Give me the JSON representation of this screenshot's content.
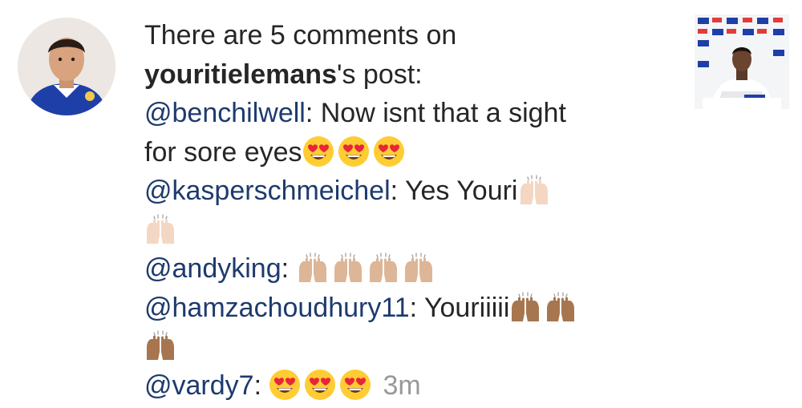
{
  "notification": {
    "intro": "There are 5 comments on",
    "post_owner": "youritielemans",
    "post_suffix": "'s post:",
    "time_ago": "3m"
  },
  "comments": [
    {
      "handle": "@benchilwell",
      "sep": ":",
      "text_part1": "Now isnt that a sight",
      "text_part2": "for sore eyes",
      "emojis": [
        "heart-eyes-emoji",
        "heart-eyes-emoji",
        "heart-eyes-emoji"
      ]
    },
    {
      "handle": "@kasperschmeichel",
      "sep": ":",
      "text": "Yes Youri",
      "emojis": [
        "raising-hands-light-emoji",
        "raising-hands-light-emoji"
      ]
    },
    {
      "handle": "@andyking",
      "sep": ":",
      "emojis": [
        "raising-hands-medium-light-emoji",
        "raising-hands-medium-light-emoji",
        "raising-hands-medium-light-emoji",
        "raising-hands-medium-light-emoji"
      ]
    },
    {
      "handle": "@hamzachoudhury11",
      "sep": ":",
      "text": "Youriiiii",
      "emojis": [
        "raising-hands-medium-emoji",
        "raising-hands-medium-emoji",
        "raising-hands-medium-emoji"
      ]
    },
    {
      "handle": "@vardy7",
      "sep": ":",
      "emojis": [
        "heart-eyes-emoji",
        "heart-eyes-emoji",
        "heart-eyes-emoji"
      ]
    }
  ],
  "colors": {
    "text": "#262626",
    "mention": "#1e3a6e",
    "timestamp": "#999999",
    "skin_light": "#f3d7c3",
    "skin_medium_light": "#ddb697",
    "skin_medium": "#a7764f",
    "emoji_face": "#ffcc33",
    "emoji_heart": "#e8253a"
  }
}
